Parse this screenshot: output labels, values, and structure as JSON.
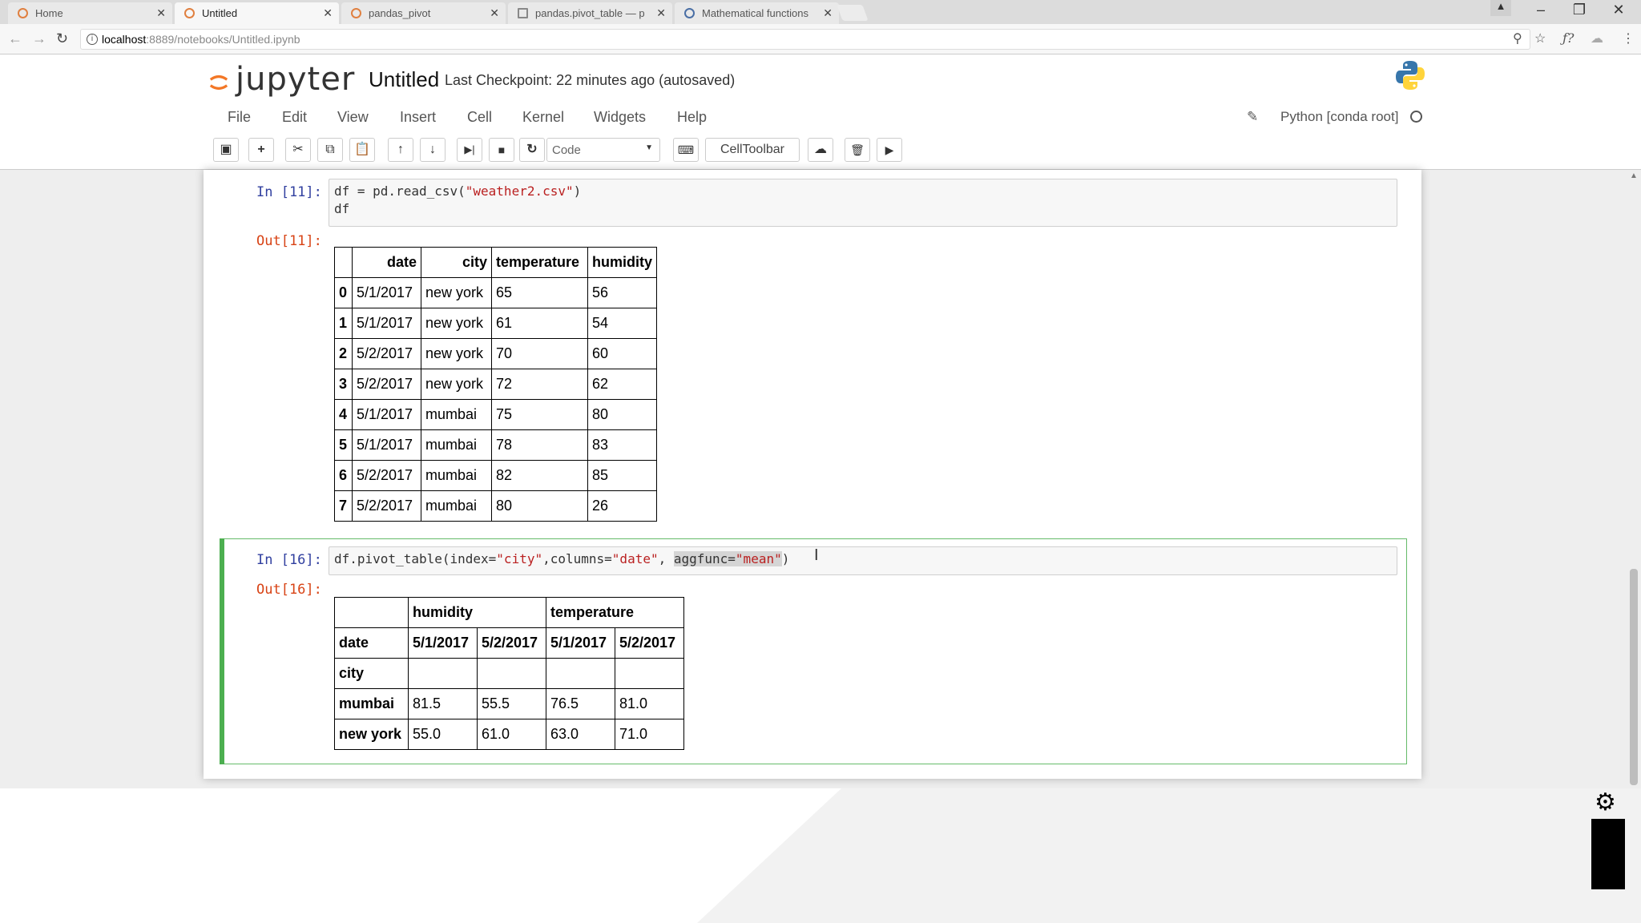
{
  "browser": {
    "tabs": [
      {
        "label": "Home",
        "active": false
      },
      {
        "label": "Untitled",
        "active": true
      },
      {
        "label": "pandas_pivot",
        "active": false
      },
      {
        "label": "pandas.pivot_table — p",
        "active": false
      },
      {
        "label": "Mathematical functions",
        "active": false
      }
    ],
    "url_host": "localhost",
    "url_path": ":8889/notebooks/Untitled.ipynb"
  },
  "header": {
    "logo_text": "jupyter",
    "title": "Untitled",
    "checkpoint": "Last Checkpoint: 22 minutes ago (autosaved)"
  },
  "menu": {
    "items": [
      "File",
      "Edit",
      "View",
      "Insert",
      "Cell",
      "Kernel",
      "Widgets",
      "Help"
    ],
    "kernel": "Python [conda root]"
  },
  "toolbar": {
    "cell_type": "Code",
    "celltoolbar_label": "CellToolbar"
  },
  "cells": {
    "c1": {
      "in_prompt": "In [11]:",
      "code_line1_pre": "df = pd.read_csv(",
      "code_line1_str": "\"weather2.csv\"",
      "code_line1_post": ")",
      "code_line2": "df",
      "out_prompt": "Out[11]:",
      "table": {
        "columns": [
          "",
          "date",
          "city",
          "temperature",
          "humidity"
        ],
        "rows": [
          [
            "0",
            "5/1/2017",
            "new york",
            "65",
            "56"
          ],
          [
            "1",
            "5/1/2017",
            "new york",
            "61",
            "54"
          ],
          [
            "2",
            "5/2/2017",
            "new york",
            "70",
            "60"
          ],
          [
            "3",
            "5/2/2017",
            "new york",
            "72",
            "62"
          ],
          [
            "4",
            "5/1/2017",
            "mumbai",
            "75",
            "80"
          ],
          [
            "5",
            "5/1/2017",
            "mumbai",
            "78",
            "83"
          ],
          [
            "6",
            "5/2/2017",
            "mumbai",
            "82",
            "85"
          ],
          [
            "7",
            "5/2/2017",
            "mumbai",
            "80",
            "26"
          ]
        ]
      }
    },
    "c2": {
      "in_prompt": "In [16]:",
      "code_a": "df.pivot_table(index=",
      "str_a": "\"city\"",
      "code_b": ",columns=",
      "str_b": "\"date\"",
      "code_c": ", ",
      "sel_a": "aggfunc=",
      "sel_str": "\"mean\"",
      "code_d": ")",
      "out_prompt": "Out[16]:",
      "pivot": {
        "top_headers": [
          "",
          "humidity",
          "temperature"
        ],
        "date_row": [
          "date",
          "5/1/2017",
          "5/2/2017",
          "5/1/2017",
          "5/2/2017"
        ],
        "index_name": "city",
        "rows": [
          [
            "mumbai",
            "81.5",
            "55.5",
            "76.5",
            "81.0"
          ],
          [
            "new york",
            "55.0",
            "61.0",
            "63.0",
            "71.0"
          ]
        ]
      }
    }
  }
}
